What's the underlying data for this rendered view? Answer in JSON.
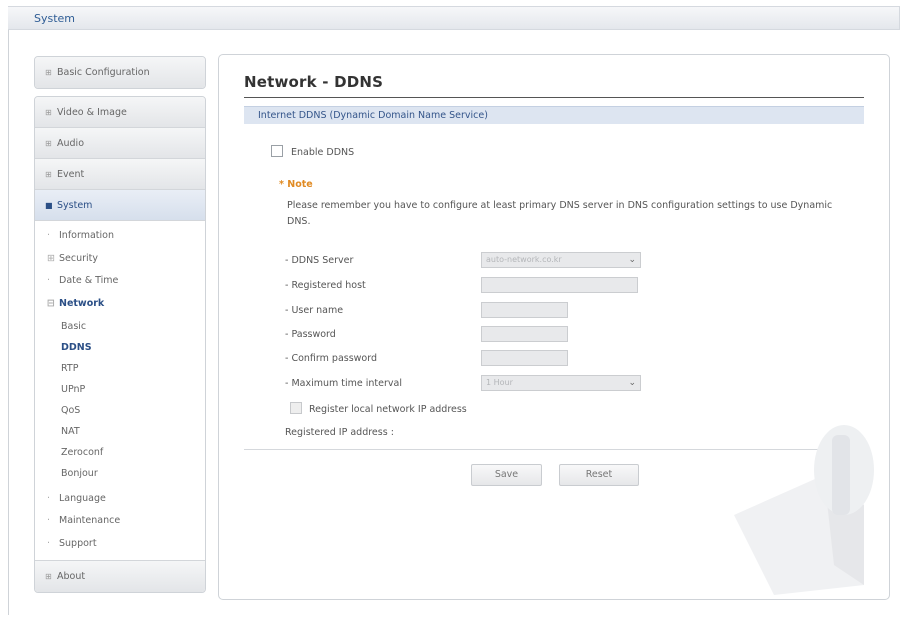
{
  "header": {
    "title": "System"
  },
  "sidebar": {
    "basic_configuration": "Basic Configuration",
    "groups": [
      "Video & Image",
      "Audio",
      "Event",
      "System"
    ],
    "system_items": [
      {
        "label": "Information"
      },
      {
        "label": "Security"
      },
      {
        "label": "Date & Time"
      },
      {
        "label": "Network"
      }
    ],
    "network_items": [
      "Basic",
      "DDNS",
      "RTP",
      "UPnP",
      "QoS",
      "NAT",
      "Zeroconf",
      "Bonjour"
    ],
    "other_items": [
      "Language",
      "Maintenance",
      "Support"
    ],
    "about": "About"
  },
  "main": {
    "title": "Network - DDNS",
    "section_title": "Internet DDNS (Dynamic Domain Name Service)",
    "enable_label": "Enable DDNS",
    "note_title": "* Note",
    "note_text": "Please remember you have to configure at least primary DNS server in DNS configuration settings to use Dynamic DNS.",
    "fields": {
      "ddns_server_label": "- DDNS Server",
      "ddns_server_value": "auto-network.co.kr",
      "registered_host_label": "- Registered host",
      "user_name_label": "- User name",
      "password_label": "- Password",
      "confirm_password_label": "- Confirm password",
      "max_interval_label": "- Maximum time interval",
      "max_interval_value": "1 Hour"
    },
    "register_label": "Register local network IP address",
    "registered_ip_label": "Registered IP address :",
    "save_label": "Save",
    "reset_label": "Reset"
  }
}
